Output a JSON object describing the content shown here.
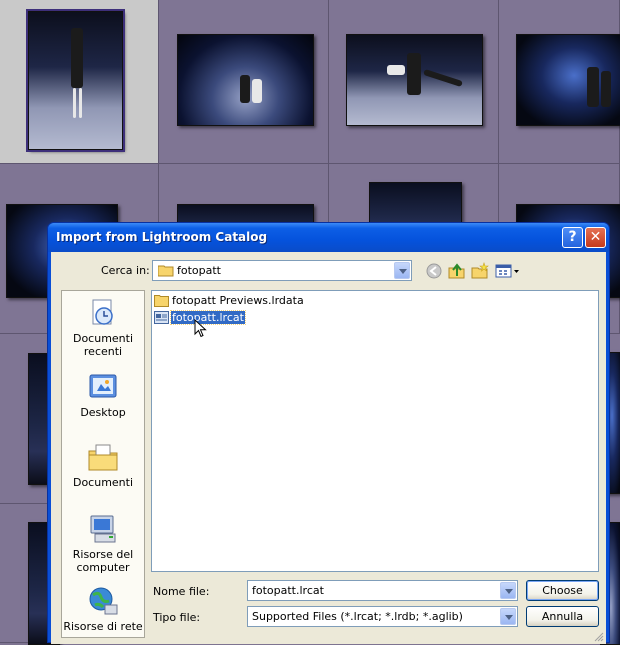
{
  "dialog": {
    "title": "Import from Lightroom Catalog",
    "look_in_label": "Cerca in:",
    "look_in_value": "fotopatt",
    "places": [
      {
        "label": "Documenti recenti",
        "icon": "recent-documents-icon"
      },
      {
        "label": "Desktop",
        "icon": "desktop-icon"
      },
      {
        "label": "Documenti",
        "icon": "my-documents-icon"
      },
      {
        "label": "Risorse del computer",
        "icon": "my-computer-icon"
      },
      {
        "label": "Risorse di rete",
        "icon": "network-places-icon"
      }
    ],
    "files": [
      {
        "name": "fotopatt Previews.lrdata",
        "icon": "folder-icon",
        "selected": false
      },
      {
        "name": "fotopatt.lrcat",
        "icon": "catalog-file-icon",
        "selected": true
      }
    ],
    "filename_label": "Nome file:",
    "filename_value": "fotopatt.lrcat",
    "filetype_label": "Tipo file:",
    "filetype_value": "Supported Files (*.lrcat; *.lrdb; *.aglib)",
    "choose_label": "Choose",
    "cancel_label": "Annulla",
    "help_label": "?",
    "close_label": "✕"
  },
  "colors": {
    "title_bar": "#0552dc",
    "dialog_face": "#ece9d8",
    "selection": "#316ac5",
    "grid_background": "#7f7594"
  }
}
